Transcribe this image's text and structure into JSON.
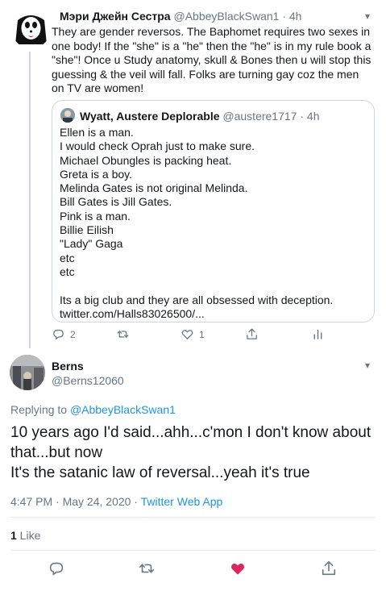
{
  "parent": {
    "name": "Мэри Джейн Сестра",
    "handle": "@AbbeyBlackSwan1",
    "dot": "·",
    "time": "4h",
    "body": "They are gender reversos. The Baphomet requires two sexes in one body! If the \"she\" is a \"he\" then the \"he\" is in my rule book a \"she\"! Once u Study anatomy, skull & Bones then u will stop this guessing & the veil will fall.  Folks are turning gay coz the men on TV are women!",
    "replies": "2",
    "likes": "1"
  },
  "quote": {
    "name": "Wyatt, Austere Deplorable",
    "handle": "@austere1717",
    "dot": "·",
    "time": "4h",
    "lines": [
      "Ellen is a man.",
      "I would check Oprah just to make sure.",
      "Michael Obungles is packing heat.",
      "Greta is a boy.",
      "Melinda Gates is not original Melinda.",
      "Bill Gates is Jill Gates.",
      "Pink is a man.",
      "Billie Eilish",
      "\"Lady\" Gaga",
      "etc",
      "etc",
      "",
      "Its a big club and they are all obsessed with deception.",
      "twitter.com/Halls83026500/..."
    ]
  },
  "reply": {
    "name": "Berns",
    "handle": "@Berns12060",
    "replying_prefix": "Replying to ",
    "replying_to": "@AbbeyBlackSwan1",
    "text_line1": "10 years ago I'd said...ahh...c'mon I don't know about that...but now",
    "text_line2": "It's the satanic law of reversal...yeah it's true",
    "timestamp": "4:47 PM · May 24, 2020 · ",
    "app": "Twitter Web App",
    "likes_count": "1",
    "likes_label": " Like"
  },
  "icons": {
    "caret": "▾",
    "reply": "reply-icon",
    "retweet": "retweet-icon",
    "like": "heart-icon",
    "share": "share-icon",
    "analytics": "analytics-icon"
  },
  "colors": {
    "link": "#1b95e0",
    "muted": "#657786",
    "liked": "#e0245e"
  }
}
